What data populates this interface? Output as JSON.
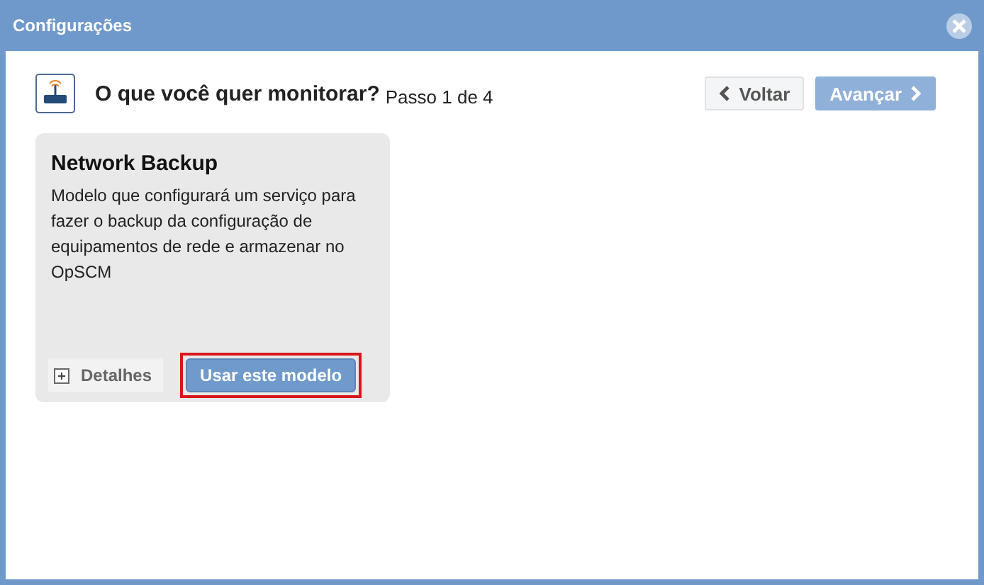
{
  "window": {
    "title": "Configurações"
  },
  "header": {
    "question": "O que você quer monitorar?",
    "step": "Passo 1 de 4"
  },
  "nav_buttons": [
    {
      "label": "Voltar",
      "kind": "back",
      "disabled": false
    },
    {
      "label": "Avançar",
      "kind": "next",
      "disabled": true
    }
  ],
  "templates": [
    {
      "title": "Network Backup",
      "description": "Modelo que configurará um serviço para fazer o backup da configuração de equipamentos de rede e armazenar no OpSCM",
      "details_label": "Detalhes",
      "use_label": "Usar este modelo",
      "highlighted": true
    }
  ]
}
